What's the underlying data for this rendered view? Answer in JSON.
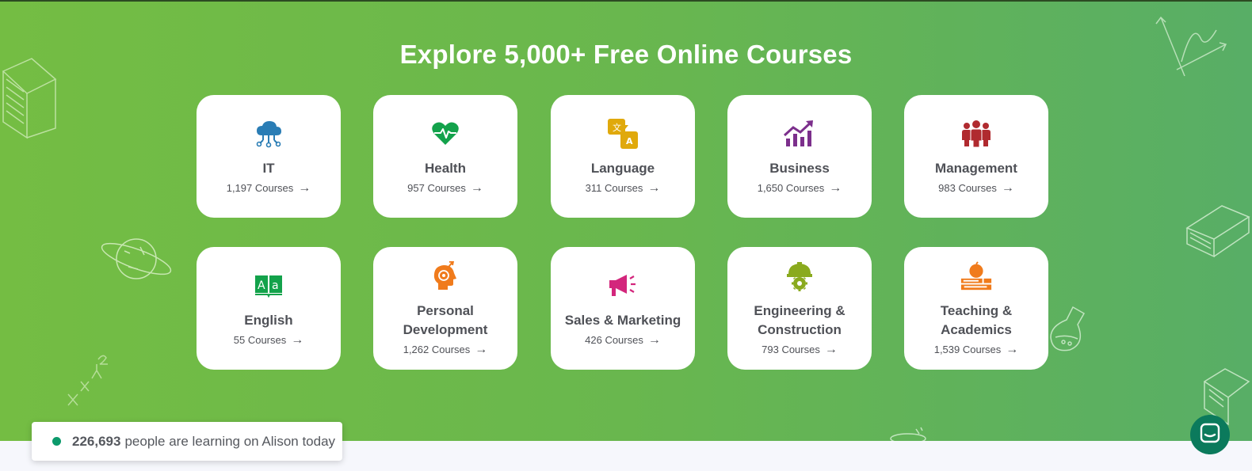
{
  "hero": {
    "title": "Explore 5,000+ Free Online Courses"
  },
  "categories": [
    {
      "name": "IT",
      "count": "1,197 Courses",
      "icon": "cloud-network-icon",
      "color": "#2a7db5"
    },
    {
      "name": "Health",
      "count": "957 Courses",
      "icon": "heart-pulse-icon",
      "color": "#13a24b"
    },
    {
      "name": "Language",
      "count": "311 Courses",
      "icon": "translate-icon",
      "color": "#e0a90c"
    },
    {
      "name": "Business",
      "count": "1,650 Courses",
      "icon": "growth-chart-icon",
      "color": "#7c2f8c"
    },
    {
      "name": "Management",
      "count": "983 Courses",
      "icon": "team-icon",
      "color": "#b02a2f"
    },
    {
      "name": "English",
      "count": "55 Courses",
      "icon": "alphabet-book-icon",
      "color": "#13a24b"
    },
    {
      "name": "Personal Development",
      "count": "1,262 Courses",
      "icon": "head-growth-icon",
      "color": "#f07b1c"
    },
    {
      "name": "Sales & Marketing",
      "count": "426 Courses",
      "icon": "megaphone-icon",
      "color": "#d3267c"
    },
    {
      "name": "Engineering & Construction",
      "count": "793 Courses",
      "icon": "hard-hat-gear-icon",
      "color": "#8aaa1e"
    },
    {
      "name": "Teaching & Academics",
      "count": "1,539 Courses",
      "icon": "apple-books-icon",
      "color": "#f07b1c"
    }
  ],
  "counter": {
    "number": "226,693",
    "text": "people are learning on Alison today"
  },
  "chat": {
    "icon": "chat-icon"
  }
}
